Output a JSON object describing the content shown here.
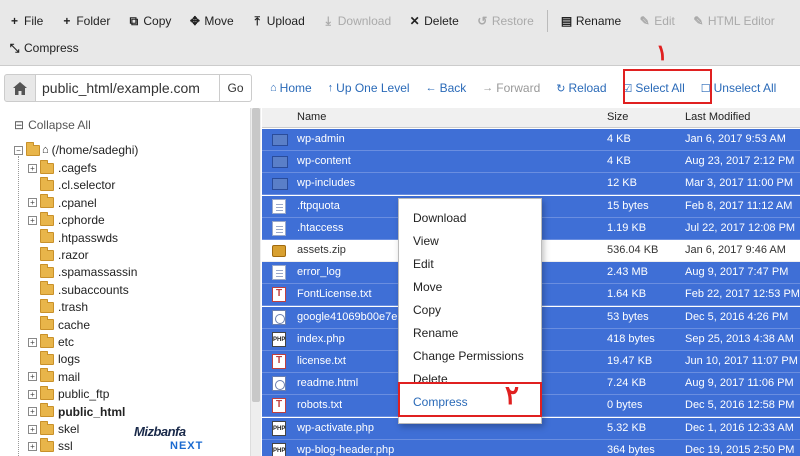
{
  "toolbar": {
    "row1": [
      {
        "label": "File",
        "icon": "+",
        "name": "new-file-button",
        "disabled": false
      },
      {
        "label": "Folder",
        "icon": "+",
        "name": "new-folder-button",
        "disabled": false
      },
      {
        "label": "Copy",
        "icon": "⧉",
        "name": "copy-button",
        "disabled": false
      },
      {
        "label": "Move",
        "icon": "✥",
        "name": "move-button",
        "disabled": false
      },
      {
        "label": "Upload",
        "icon": "⤒",
        "name": "upload-button",
        "disabled": false
      },
      {
        "label": "Download",
        "icon": "⤓",
        "name": "download-button",
        "disabled": true
      },
      {
        "label": "Delete",
        "icon": "✕",
        "name": "delete-button",
        "disabled": false
      },
      {
        "label": "Restore",
        "icon": "↺",
        "name": "restore-button",
        "disabled": true
      },
      {
        "label": "Rename",
        "icon": "▤",
        "name": "rename-button",
        "disabled": false
      },
      {
        "label": "Edit",
        "icon": "✎",
        "name": "edit-button",
        "disabled": true
      },
      {
        "label": "HTML Editor",
        "icon": "✎",
        "name": "html-editor-button",
        "disabled": true
      }
    ],
    "row2": [
      {
        "label": "Compress",
        "icon": "⤡",
        "name": "compress-button",
        "disabled": false
      }
    ]
  },
  "address": {
    "path": "public_html/example.com",
    "go_label": "Go"
  },
  "nav": {
    "home": "Home",
    "up": "Up One Level",
    "back": "Back",
    "forward": "Forward",
    "reload": "Reload",
    "select_all": "Select All",
    "unselect_all": "Unselect All"
  },
  "badges": {
    "one": "١",
    "two": "٢"
  },
  "tree": {
    "collapse_label": "Collapse All",
    "root": "(/home/sadeghi)",
    "items": [
      {
        "label": ".cagefs",
        "expandable": true,
        "bold": false
      },
      {
        "label": ".cl.selector",
        "expandable": false,
        "bold": false
      },
      {
        "label": ".cpanel",
        "expandable": true,
        "bold": false
      },
      {
        "label": ".cphorde",
        "expandable": true,
        "bold": false
      },
      {
        "label": ".htpasswds",
        "expandable": false,
        "bold": false
      },
      {
        "label": ".razor",
        "expandable": false,
        "bold": false
      },
      {
        "label": ".spamassassin",
        "expandable": false,
        "bold": false
      },
      {
        "label": ".subaccounts",
        "expandable": false,
        "bold": false
      },
      {
        "label": ".trash",
        "expandable": false,
        "bold": false
      },
      {
        "label": "cache",
        "expandable": false,
        "bold": false
      },
      {
        "label": "etc",
        "expandable": true,
        "bold": false
      },
      {
        "label": "logs",
        "expandable": false,
        "bold": false
      },
      {
        "label": "mail",
        "expandable": true,
        "bold": false
      },
      {
        "label": "public_ftp",
        "expandable": true,
        "bold": false
      },
      {
        "label": "public_html",
        "expandable": true,
        "bold": true
      },
      {
        "label": "skel",
        "expandable": true,
        "bold": false
      },
      {
        "label": "ssl",
        "expandable": true,
        "bold": false
      }
    ]
  },
  "table": {
    "headers": {
      "name": "Name",
      "size": "Size",
      "modified": "Last Modified"
    },
    "rows": [
      {
        "name": "wp-admin",
        "size": "4 KB",
        "modified": "Jan 6, 2017 9:53 AM",
        "type": "folder",
        "selected": true
      },
      {
        "name": "wp-content",
        "size": "4 KB",
        "modified": "Aug 23, 2017 2:12 PM",
        "type": "folder",
        "selected": true
      },
      {
        "name": "wp-includes",
        "size": "12 KB",
        "modified": "Mar 3, 2017 11:00 PM",
        "type": "folder",
        "selected": true
      },
      {
        "name": ".ftpquota",
        "size": "15 bytes",
        "modified": "Feb 8, 2017 11:12 AM",
        "type": "doc",
        "selected": true
      },
      {
        "name": ".htaccess",
        "size": "1.19 KB",
        "modified": "Jul 22, 2017 12:08 PM",
        "type": "doc",
        "selected": true
      },
      {
        "name": "assets.zip",
        "size": "536.04 KB",
        "modified": "Jan 6, 2017 9:46 AM",
        "type": "zip",
        "selected": false
      },
      {
        "name": "error_log",
        "size": "2.43 MB",
        "modified": "Aug 9, 2017 7:47 PM",
        "type": "doc",
        "selected": true
      },
      {
        "name": "FontLicense.txt",
        "size": "1.64 KB",
        "modified": "Feb 22, 2017 12:53 PM",
        "type": "txt",
        "selected": true
      },
      {
        "name": "google41069b00e7e",
        "size": "53 bytes",
        "modified": "Dec 5, 2016 4:26 PM",
        "type": "html",
        "selected": true
      },
      {
        "name": "index.php",
        "size": "418 bytes",
        "modified": "Sep 25, 2013 4:38 AM",
        "type": "php",
        "selected": true
      },
      {
        "name": "license.txt",
        "size": "19.47 KB",
        "modified": "Jun 10, 2017 11:07 PM",
        "type": "txt",
        "selected": true
      },
      {
        "name": "readme.html",
        "size": "7.24 KB",
        "modified": "Aug 9, 2017 11:06 PM",
        "type": "html",
        "selected": true
      },
      {
        "name": "robots.txt",
        "size": "0 bytes",
        "modified": "Dec 5, 2016 12:58 PM",
        "type": "txt",
        "selected": true
      },
      {
        "name": "wp-activate.php",
        "size": "5.32 KB",
        "modified": "Dec 1, 2016 12:33 AM",
        "type": "php",
        "selected": true
      },
      {
        "name": "wp-blog-header.php",
        "size": "364 bytes",
        "modified": "Dec 19, 2015 2:50 PM",
        "type": "php",
        "selected": true
      }
    ]
  },
  "context_menu": {
    "items": [
      "Download",
      "View",
      "Edit",
      "Move",
      "Copy",
      "Rename",
      "Change Permissions",
      "Delete",
      "Compress"
    ]
  },
  "logo": {
    "top": "Mizbanfa",
    "bottom": "NEXT"
  }
}
